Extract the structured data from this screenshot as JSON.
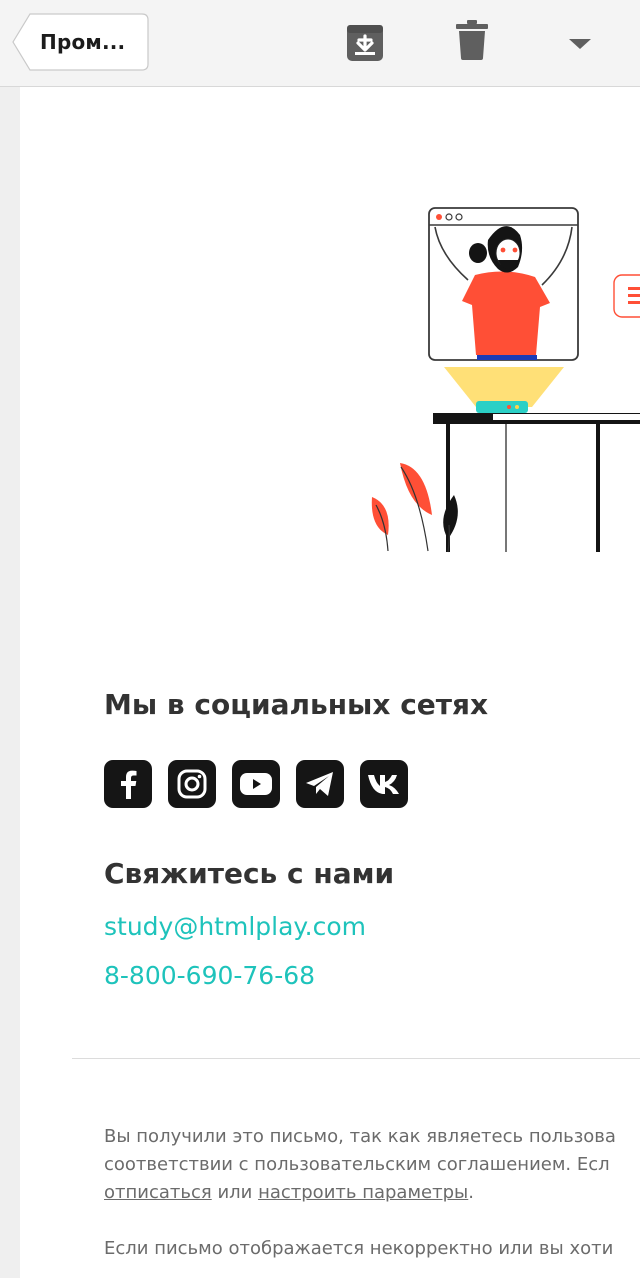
{
  "toolbar": {
    "back_label": "Пром...",
    "icons": [
      "archive-icon",
      "trash-icon",
      "dropdown-arrow-icon"
    ]
  },
  "email": {
    "social_heading": "Мы в социальных сетях",
    "socials": [
      {
        "name": "facebook",
        "icon": "facebook-icon"
      },
      {
        "name": "instagram",
        "icon": "instagram-icon"
      },
      {
        "name": "youtube",
        "icon": "youtube-icon"
      },
      {
        "name": "telegram",
        "icon": "telegram-icon"
      },
      {
        "name": "vk",
        "icon": "vk-icon"
      }
    ],
    "contact_heading": "Свяжитесь с нами",
    "email_link": "study@htmlplay.com",
    "phone_link": "8-800-690-76-68",
    "footer": {
      "line1": "Вы получили это письмо, так как являетесь пользова",
      "line2": "соответствии с пользовательским соглашением. Есл",
      "unsubscribe": "отписаться",
      "or": " или ",
      "settings": "настроить параметры",
      "period": ".",
      "line4": "Если письмо отображается некорректно или вы хоти"
    }
  },
  "colors": {
    "accent": "#1ec3bb",
    "heading": "#333333",
    "social_bg": "#151515",
    "illustration_red": "#ff4f36"
  }
}
